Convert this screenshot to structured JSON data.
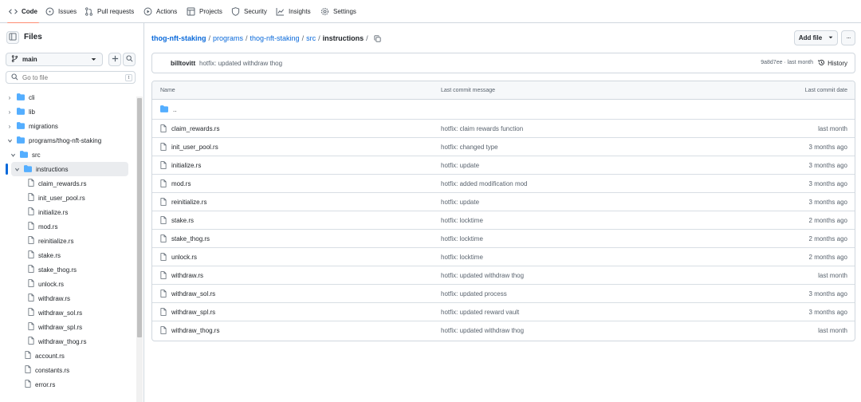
{
  "topnav": {
    "tabs": [
      {
        "label": "Code",
        "icon": "code-icon"
      },
      {
        "label": "Issues",
        "icon": "issue-icon"
      },
      {
        "label": "Pull requests",
        "icon": "pull-request-icon"
      },
      {
        "label": "Actions",
        "icon": "play-icon"
      },
      {
        "label": "Projects",
        "icon": "table-icon"
      },
      {
        "label": "Security",
        "icon": "shield-icon"
      },
      {
        "label": "Insights",
        "icon": "graph-icon"
      },
      {
        "label": "Settings",
        "icon": "gear-icon"
      }
    ],
    "active_tab": "Code"
  },
  "sidebar": {
    "title": "Files",
    "branch": "main",
    "search_placeholder": "Go to file",
    "shortcut_key": "t",
    "tree": [
      {
        "label": "cli",
        "type": "folder",
        "expanded": false,
        "depth": 0
      },
      {
        "label": "lib",
        "type": "folder",
        "expanded": false,
        "depth": 0
      },
      {
        "label": "migrations",
        "type": "folder",
        "expanded": false,
        "depth": 0
      },
      {
        "label": "programs/thog-nft-staking",
        "type": "folder",
        "expanded": true,
        "depth": 0
      },
      {
        "label": "src",
        "type": "folder",
        "expanded": true,
        "depth": 1
      },
      {
        "label": "instructions",
        "type": "folder",
        "expanded": true,
        "depth": 2,
        "selected": true
      },
      {
        "label": "claim_rewards.rs",
        "type": "file",
        "depth": 3
      },
      {
        "label": "init_user_pool.rs",
        "type": "file",
        "depth": 3
      },
      {
        "label": "initialize.rs",
        "type": "file",
        "depth": 3
      },
      {
        "label": "mod.rs",
        "type": "file",
        "depth": 3
      },
      {
        "label": "reinitialize.rs",
        "type": "file",
        "depth": 3
      },
      {
        "label": "stake.rs",
        "type": "file",
        "depth": 3
      },
      {
        "label": "stake_thog.rs",
        "type": "file",
        "depth": 3
      },
      {
        "label": "unlock.rs",
        "type": "file",
        "depth": 3
      },
      {
        "label": "withdraw.rs",
        "type": "file",
        "depth": 3
      },
      {
        "label": "withdraw_sol.rs",
        "type": "file",
        "depth": 3
      },
      {
        "label": "withdraw_spl.rs",
        "type": "file",
        "depth": 3
      },
      {
        "label": "withdraw_thog.rs",
        "type": "file",
        "depth": 3
      },
      {
        "label": "account.rs",
        "type": "file",
        "depth": 2
      },
      {
        "label": "constants.rs",
        "type": "file",
        "depth": 2
      },
      {
        "label": "error.rs",
        "type": "file",
        "depth": 2
      }
    ]
  },
  "breadcrumb": {
    "parts": [
      "thog-nft-staking",
      "programs",
      "thog-nft-staking",
      "src"
    ],
    "current": "instructions",
    "separator": "/"
  },
  "actions": {
    "add_file": "Add file",
    "more": "···"
  },
  "commit": {
    "author": "billtovitt",
    "message": "hotfix: updated withdraw thog",
    "meta": "9a8d7ee · last month",
    "history_label": "History"
  },
  "table": {
    "headers": {
      "name": "Name",
      "message": "Last commit message",
      "date": "Last commit date"
    },
    "parent": "..",
    "rows": [
      {
        "name": "claim_rewards.rs",
        "message": "hotfix: claim rewards function",
        "date": "last month"
      },
      {
        "name": "init_user_pool.rs",
        "message": "hotfix: changed type",
        "date": "3 months ago"
      },
      {
        "name": "initialize.rs",
        "message": "hotfix: update",
        "date": "3 months ago"
      },
      {
        "name": "mod.rs",
        "message": "hotfix: added modification mod",
        "date": "3 months ago"
      },
      {
        "name": "reinitialize.rs",
        "message": "hotfix: update",
        "date": "3 months ago"
      },
      {
        "name": "stake.rs",
        "message": "hotfix: locktime",
        "date": "2 months ago"
      },
      {
        "name": "stake_thog.rs",
        "message": "hotfix: locktime",
        "date": "2 months ago"
      },
      {
        "name": "unlock.rs",
        "message": "hotfix: locktime",
        "date": "2 months ago"
      },
      {
        "name": "withdraw.rs",
        "message": "hotfix: updated withdraw thog",
        "date": "last month"
      },
      {
        "name": "withdraw_sol.rs",
        "message": "hotfix: updated process",
        "date": "3 months ago"
      },
      {
        "name": "withdraw_spl.rs",
        "message": "hotfix: updated reward vault",
        "date": "3 months ago"
      },
      {
        "name": "withdraw_thog.rs",
        "message": "hotfix: updated withdraw thog",
        "date": "last month"
      }
    ]
  },
  "colors": {
    "link": "#0969da",
    "folder": "#54aeff",
    "muted": "#59636e",
    "border": "#d0d7de",
    "active_tab_underline": "#fd8c73"
  }
}
